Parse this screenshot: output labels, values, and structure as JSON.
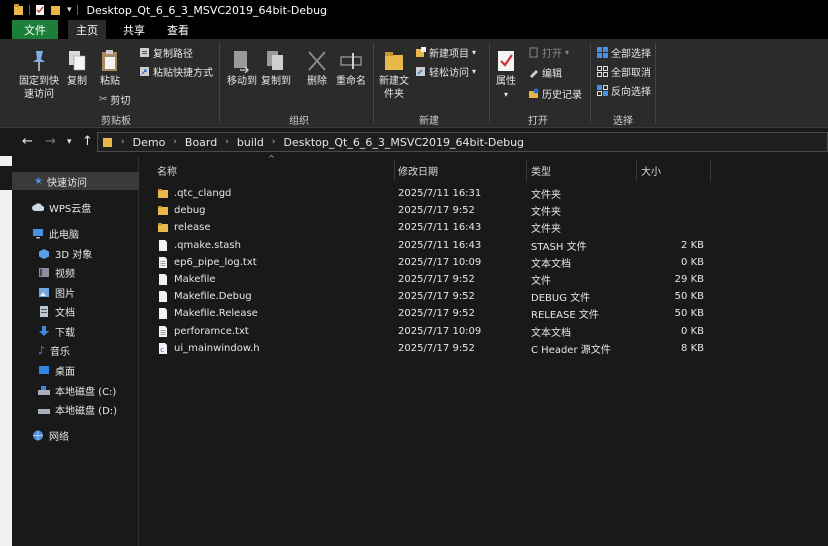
{
  "window": {
    "title": "Desktop_Qt_6_6_3_MSVC2019_64bit-Debug"
  },
  "menu_tabs": [
    "文件",
    "主页",
    "共享",
    "查看"
  ],
  "ribbon": {
    "pin": "固定到快速访问",
    "copy": "复制",
    "paste": "粘贴",
    "copy_path": "复制路径",
    "paste_shortcut": "粘贴快捷方式",
    "cut": "剪切",
    "move_to": "移动到",
    "copy_to": "复制到",
    "delete": "删除",
    "rename": "重命名",
    "new_folder": "新建文件夹",
    "new_item": "新建项目",
    "easy_access": "轻松访问",
    "properties": "属性",
    "open": "打开",
    "edit": "编辑",
    "history": "历史记录",
    "select_all": "全部选择",
    "select_none": "全部取消",
    "invert": "反向选择",
    "groups": {
      "clipboard": "剪贴板",
      "organize": "组织",
      "new": "新建",
      "open": "打开",
      "select": "选择"
    }
  },
  "breadcrumb": [
    "Demo",
    "Board",
    "build",
    "Desktop_Qt_6_6_3_MSVC2019_64bit-Debug"
  ],
  "sidebar": {
    "quick_access": "快速访问",
    "wps": "WPS云盘",
    "this_pc": "此电脑",
    "items": [
      "3D 对象",
      "视频",
      "图片",
      "文档",
      "下载",
      "音乐",
      "桌面",
      "本地磁盘 (C:)",
      "本地磁盘 (D:)"
    ],
    "network": "网络"
  },
  "columns": {
    "name": "名称",
    "date": "修改日期",
    "type": "类型",
    "size": "大小"
  },
  "files": [
    {
      "name": ".qtc_clangd",
      "date": "2025/7/11 16:31",
      "type": "文件夹",
      "size": "",
      "icon": "folder-icon"
    },
    {
      "name": "debug",
      "date": "2025/7/17 9:52",
      "type": "文件夹",
      "size": "",
      "icon": "folder-icon"
    },
    {
      "name": "release",
      "date": "2025/7/11 16:43",
      "type": "文件夹",
      "size": "",
      "icon": "folder-icon"
    },
    {
      "name": ".qmake.stash",
      "date": "2025/7/11 16:43",
      "type": "STASH 文件",
      "size": "2 KB",
      "icon": "file-icon"
    },
    {
      "name": "ep6_pipe_log.txt",
      "date": "2025/7/17 10:09",
      "type": "文本文档",
      "size": "0 KB",
      "icon": "text-file-icon"
    },
    {
      "name": "Makefile",
      "date": "2025/7/17 9:52",
      "type": "文件",
      "size": "29 KB",
      "icon": "file-icon"
    },
    {
      "name": "Makefile.Debug",
      "date": "2025/7/17 9:52",
      "type": "DEBUG 文件",
      "size": "50 KB",
      "icon": "file-icon"
    },
    {
      "name": "Makefile.Release",
      "date": "2025/7/17 9:52",
      "type": "RELEASE 文件",
      "size": "50 KB",
      "icon": "file-icon"
    },
    {
      "name": "perforamce.txt",
      "date": "2025/7/17 10:09",
      "type": "文本文档",
      "size": "0 KB",
      "icon": "text-file-icon"
    },
    {
      "name": "ui_mainwindow.h",
      "date": "2025/7/17 9:52",
      "type": "C Header 源文件",
      "size": "8 KB",
      "icon": "c-header-icon"
    }
  ],
  "colors": {
    "file_tab": "#1b7f3a",
    "ribbon_bg": "#2b2b2b",
    "folder": "#e8b84a",
    "background": "#191919"
  }
}
